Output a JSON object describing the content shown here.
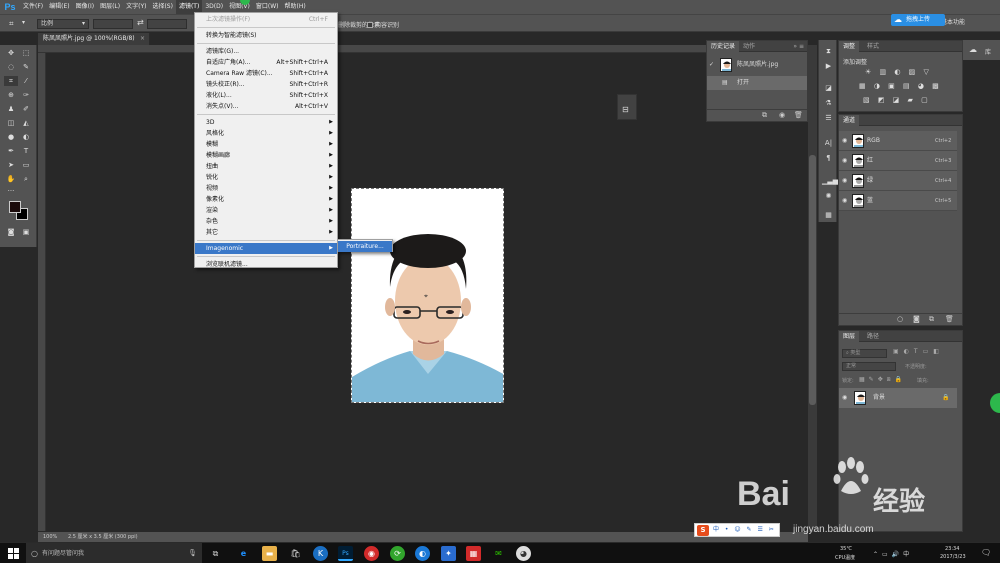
{
  "app": {
    "logo": "Ps",
    "menu": [
      "文件(F)",
      "编辑(E)",
      "图像(I)",
      "图层(L)",
      "文字(Y)",
      "选择(S)",
      "滤镜(T)",
      "3D(D)",
      "视图(V)",
      "窗口(W)",
      "帮助(H)"
    ],
    "active_menu_index": 6
  },
  "options": {
    "ratio_select": "比例",
    "swap_icon": "⇄",
    "delete_pixels_label": "删除裁剪的像素",
    "content_aware_label": "内容识别",
    "workspace": "基本功能"
  },
  "upload_button": "拖拽上传",
  "document": {
    "tab_title": "陈凤凤照片.jpg @ 100%(RGB/8)",
    "close": "×"
  },
  "status": {
    "zoom": "100%",
    "info": "2.5 厘米 x 3.5 厘米 (300 ppi)"
  },
  "filter_menu": {
    "items": [
      {
        "label": "上次滤镜操作(F)",
        "shortcut": "Ctrl+F",
        "disabled": true
      },
      {
        "sep": true
      },
      {
        "label": "转换为智能滤镜(S)"
      },
      {
        "sep": true
      },
      {
        "label": "滤镜库(G)..."
      },
      {
        "label": "自适应广角(A)...",
        "shortcut": "Alt+Shift+Ctrl+A"
      },
      {
        "label": "Camera Raw 滤镜(C)...",
        "shortcut": "Shift+Ctrl+A"
      },
      {
        "label": "镜头校正(R)...",
        "shortcut": "Shift+Ctrl+R"
      },
      {
        "label": "液化(L)...",
        "shortcut": "Shift+Ctrl+X"
      },
      {
        "label": "消失点(V)...",
        "shortcut": "Alt+Ctrl+V"
      },
      {
        "sep": true
      },
      {
        "label": "3D",
        "submenu": true
      },
      {
        "label": "风格化",
        "submenu": true
      },
      {
        "label": "模糊",
        "submenu": true
      },
      {
        "label": "模糊画廊",
        "submenu": true
      },
      {
        "label": "扭曲",
        "submenu": true
      },
      {
        "label": "锐化",
        "submenu": true
      },
      {
        "label": "视频",
        "submenu": true
      },
      {
        "label": "像素化",
        "submenu": true
      },
      {
        "label": "渲染",
        "submenu": true
      },
      {
        "label": "杂色",
        "submenu": true
      },
      {
        "label": "其它",
        "submenu": true
      },
      {
        "sep": true
      },
      {
        "label": "Imagenomic",
        "submenu": true,
        "highlighted": true
      },
      {
        "sep": true
      },
      {
        "label": "浏览联机滤镜..."
      }
    ],
    "submenu_item": "Portraiture..."
  },
  "history": {
    "tabs": [
      "历史记录",
      "动作"
    ],
    "snapshot": "陈凤凤照片.jpg",
    "step": "打开"
  },
  "adjustments": {
    "tabs": [
      "调整",
      "样式"
    ],
    "add_label": "添加调整",
    "row1": "☀ ▥ ◐ ▨ ▽",
    "row2": "▦ ◑ ▣ ▤ ◕ ▩",
    "row3": "▧ ◩ ◪ ▰ ▢"
  },
  "channels": {
    "tab": "通道",
    "rows": [
      {
        "name": "RGB",
        "shortcut": "Ctrl+2"
      },
      {
        "name": "红",
        "shortcut": "Ctrl+3"
      },
      {
        "name": "绿",
        "shortcut": "Ctrl+4"
      },
      {
        "name": "蓝",
        "shortcut": "Ctrl+5"
      }
    ]
  },
  "layers": {
    "tabs": [
      "图层",
      "路径"
    ],
    "filter_placeholder": "类型",
    "blend_mode": "正常",
    "opacity_label": "不透明度:",
    "lock_label": "锁定:",
    "fill_label": "填充:",
    "layer_name": "背景"
  },
  "right_strip": {
    "label": "库"
  },
  "taskbar": {
    "search_placeholder": "有问题尽管问我",
    "temp": "35℃",
    "temp_label": "CPU温度",
    "time": "23:34",
    "date": "2017/3/23"
  },
  "ime": {
    "badge": "S",
    "text": "中 • ☺ ✎ ☰ ✂"
  },
  "watermark": {
    "brand_prefix": "Bai",
    "brand_mid": "经验",
    "url": "jingyan.baidu.com"
  }
}
